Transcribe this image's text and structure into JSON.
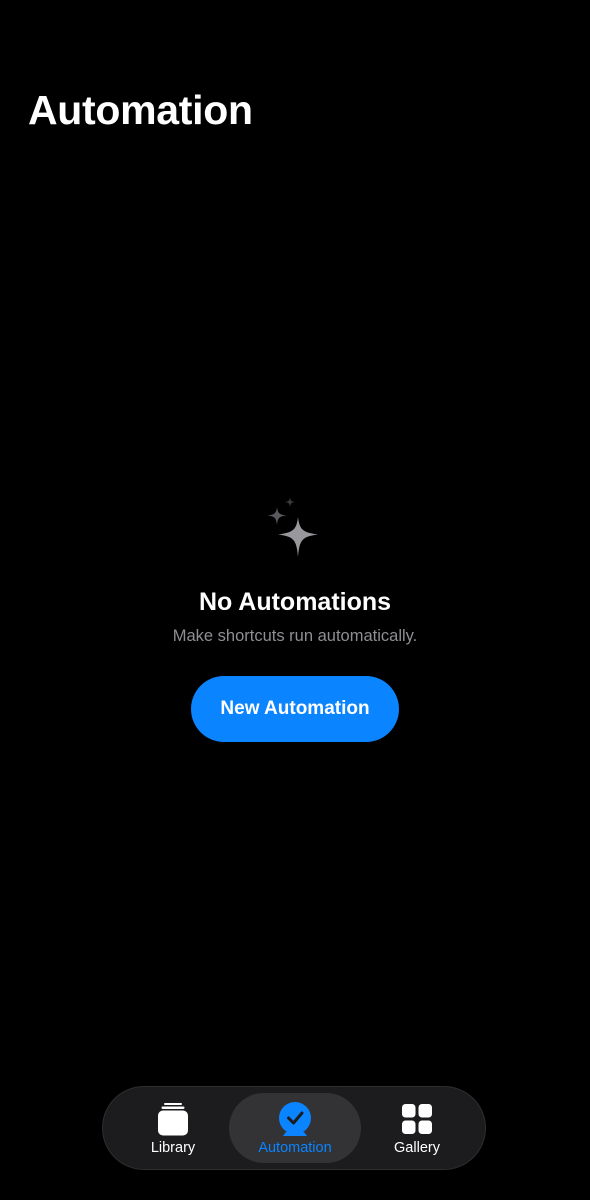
{
  "header": {
    "title": "Automation"
  },
  "empty_state": {
    "icon": "sparkles-icon",
    "title": "No Automations",
    "subtitle": "Make shortcuts run automatically.",
    "button_label": "New Automation"
  },
  "tab_bar": {
    "items": [
      {
        "label": "Library",
        "icon": "library-stack-icon",
        "selected": false
      },
      {
        "label": "Automation",
        "icon": "automation-clock-icon",
        "selected": true
      },
      {
        "label": "Gallery",
        "icon": "gallery-grid-icon",
        "selected": false
      }
    ]
  },
  "colors": {
    "background": "#000000",
    "accent": "#0a84ff",
    "secondary_text": "#8e8e93",
    "tab_bar": "#1c1c1e",
    "tab_selected": "#333336"
  }
}
